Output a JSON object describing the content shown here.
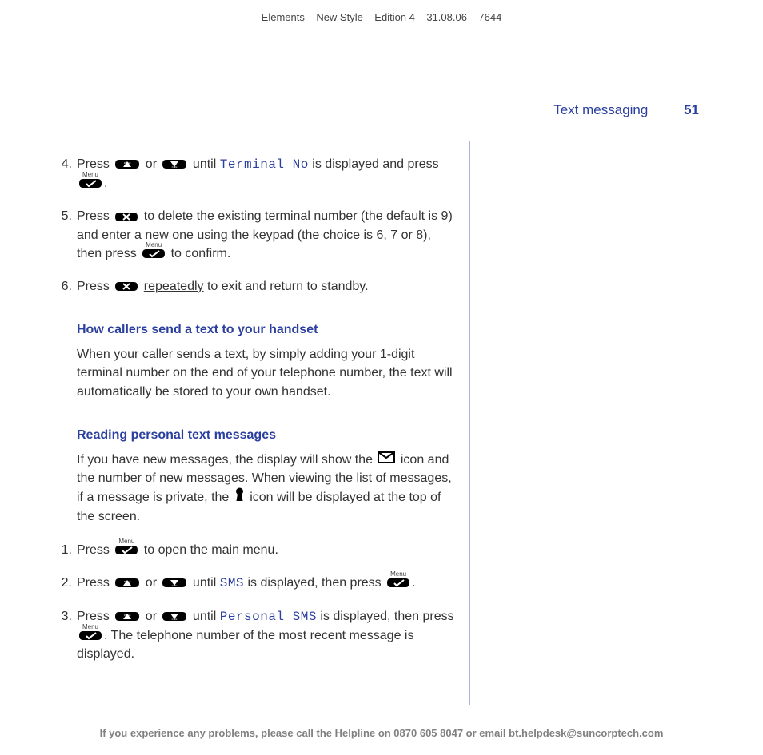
{
  "header": "Elements – New Style – Edition 4 – 31.08.06 – 7644",
  "section_title": "Text messaging",
  "page_number": "51",
  "icons": {
    "menu_label": "Menu"
  },
  "stepsA": [
    {
      "num": "4.",
      "parts": [
        {
          "t": "text",
          "v": "Press "
        },
        {
          "t": "key-up"
        },
        {
          "t": "text",
          "v": " or "
        },
        {
          "t": "key-down"
        },
        {
          "t": "text",
          "v": " until "
        },
        {
          "t": "display",
          "v": "Terminal No"
        },
        {
          "t": "text",
          "v": " is displayed and press "
        },
        {
          "t": "key-menu"
        },
        {
          "t": "text",
          "v": "."
        }
      ]
    },
    {
      "num": "5.",
      "parts": [
        {
          "t": "text",
          "v": "Press "
        },
        {
          "t": "key-x"
        },
        {
          "t": "text",
          "v": " to delete the existing terminal number (the default is 9) and enter a new one using the keypad (the choice is 6, 7 or 8), then press "
        },
        {
          "t": "key-menu"
        },
        {
          "t": "text",
          "v": " to confirm."
        }
      ]
    },
    {
      "num": "6.",
      "parts": [
        {
          "t": "text",
          "v": "Press "
        },
        {
          "t": "key-x"
        },
        {
          "t": "text",
          "v": " "
        },
        {
          "t": "underline",
          "v": "repeatedly"
        },
        {
          "t": "text",
          "v": " to exit and return to standby."
        }
      ]
    }
  ],
  "sub1": {
    "title": "How callers send a text to your handset",
    "body": "When your caller sends a text, by simply adding your 1-digit terminal number on the end of your telephone number, the text will automatically be stored to your own handset."
  },
  "sub2": {
    "title": "Reading personal text messages",
    "intro_parts": [
      {
        "t": "text",
        "v": "If you have new messages, the display will show the "
      },
      {
        "t": "envelope"
      },
      {
        "t": "text",
        "v": " icon and the number of new messages. When viewing the list of messages, if a message is private, the "
      },
      {
        "t": "keyhole"
      },
      {
        "t": "text",
        "v": " icon will be displayed at the top of the screen."
      }
    ]
  },
  "stepsB": [
    {
      "num": "1.",
      "parts": [
        {
          "t": "text",
          "v": "Press "
        },
        {
          "t": "key-menu"
        },
        {
          "t": "text",
          "v": " to open the main menu."
        }
      ]
    },
    {
      "num": "2.",
      "parts": [
        {
          "t": "text",
          "v": "Press "
        },
        {
          "t": "key-up"
        },
        {
          "t": "text",
          "v": " or "
        },
        {
          "t": "key-down"
        },
        {
          "t": "text",
          "v": " until "
        },
        {
          "t": "display",
          "v": "SMS"
        },
        {
          "t": "text",
          "v": " is displayed, then press "
        },
        {
          "t": "key-menu"
        },
        {
          "t": "text",
          "v": "."
        }
      ]
    },
    {
      "num": "3.",
      "parts": [
        {
          "t": "text",
          "v": "Press "
        },
        {
          "t": "key-up"
        },
        {
          "t": "text",
          "v": " or "
        },
        {
          "t": "key-down"
        },
        {
          "t": "text",
          "v": " until "
        },
        {
          "t": "display",
          "v": "Personal SMS"
        },
        {
          "t": "text",
          "v": " is displayed, then press "
        },
        {
          "t": "key-menu"
        },
        {
          "t": "text",
          "v": ". The telephone number of the most recent message is displayed."
        }
      ]
    }
  ],
  "footer": "If you experience any problems, please call the Helpline on 0870 605 8047 or email bt.helpdesk@suncorptech.com"
}
